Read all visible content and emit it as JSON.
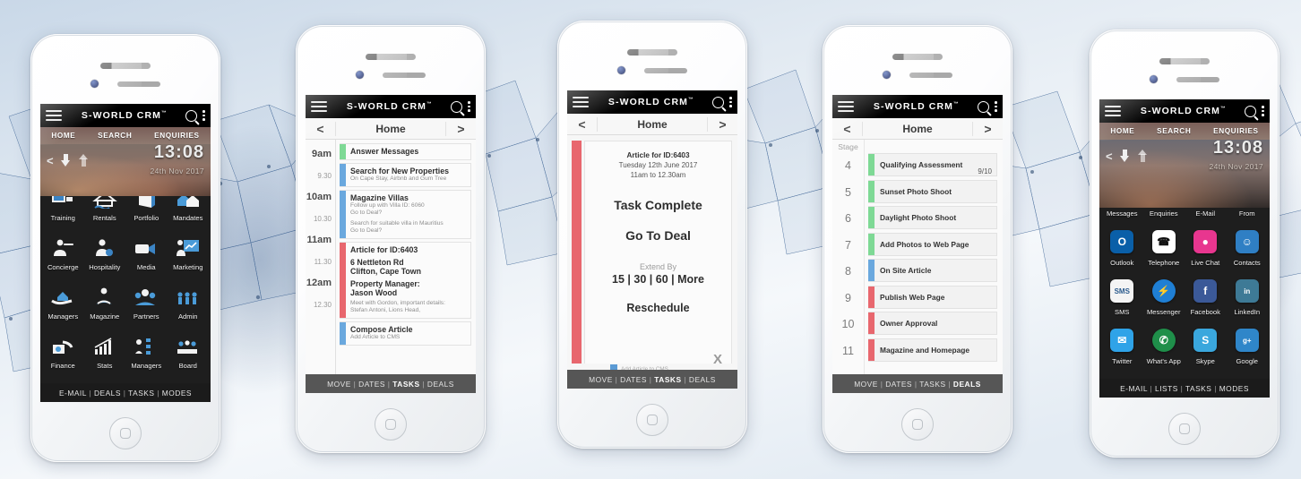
{
  "app": {
    "brand": "S-WORLD CRM",
    "brand_tm": "™",
    "icons": {
      "menu": "hamburger-icon",
      "search": "search-icon",
      "overflow": "kebab-menu-icon"
    }
  },
  "colors": {
    "green": "#7ed995",
    "blue": "#6aa8de",
    "red": "#e8676e",
    "bar_dark": "#1b1b1b",
    "bar_grey": "#565656",
    "accent_blue": "#1c4d86"
  },
  "phone1": {
    "subnav": [
      "HOME",
      "SEARCH",
      "ENQUIRIES"
    ],
    "clock": {
      "time": "13:08",
      "date": "24th Nov 2017",
      "back": "<",
      "download": "download-icon",
      "upload": "upload-icon"
    },
    "tiles": [
      {
        "label": "Training",
        "icon": "training-board-icon"
      },
      {
        "label": "Rentals",
        "icon": "house-water-icon"
      },
      {
        "label": "Portfolio",
        "icon": "portfolio-folder-icon"
      },
      {
        "label": "Mandates",
        "icon": "two-houses-icon"
      },
      {
        "label": "Concierge",
        "icon": "waiter-icon"
      },
      {
        "label": "Hospitality",
        "icon": "hostess-gear-icon"
      },
      {
        "label": "Media",
        "icon": "video-camera-icon"
      },
      {
        "label": "Marketing",
        "icon": "presenter-chart-icon"
      },
      {
        "label": "Managers",
        "icon": "hand-house-icon"
      },
      {
        "label": "Magazine",
        "icon": "reading-person-icon"
      },
      {
        "label": "Partners",
        "icon": "people-group-icon"
      },
      {
        "label": "Admin",
        "icon": "people-gears-icon"
      },
      {
        "label": "Finance",
        "icon": "hand-money-icon"
      },
      {
        "label": "Stats",
        "icon": "bar-chart-icon"
      },
      {
        "label": "Managers",
        "icon": "org-chart-icon"
      },
      {
        "label": "Board",
        "icon": "boardroom-icon"
      }
    ],
    "bottom": {
      "items": [
        "E-MAIL",
        "DEALS",
        "TASKS",
        "MODES"
      ],
      "active": ""
    }
  },
  "phone2": {
    "nav": {
      "prev": "<",
      "title": "Home",
      "next": ">"
    },
    "times": [
      "9am",
      "9.30",
      "10am",
      "10.30",
      "11am",
      "11.30",
      "12am",
      "12.30"
    ],
    "events": [
      {
        "color": "green",
        "title": "Answer Messages",
        "lines": []
      },
      {
        "color": "blue",
        "title": "Search for New Properties",
        "lines": [
          "On Cape Stay, Airbnb and Gum Tree"
        ]
      },
      {
        "color": "blue",
        "title": "Magazine Villas",
        "lines": [
          "Follow up with Villa ID: 6060",
          "Go to Deal?",
          "",
          "Search for suitable villa in Mauritius",
          "Go to Deal?"
        ]
      },
      {
        "color": "red",
        "title": "Article for ID:6403",
        "lines": [
          "6 Nettleton Rd",
          "Clifton, Cape Town",
          "Property Manager:",
          "Jason Wood",
          "Meet with Gordon, important details:",
          "Stefan Antoni, Lions Head,"
        ]
      },
      {
        "color": "blue",
        "title": "Compose Article",
        "lines": [
          "Add Article to CMS"
        ]
      }
    ],
    "bottom": {
      "items": [
        "MOVE",
        "DATES",
        "TASKS",
        "DEALS"
      ],
      "active": "TASKS"
    }
  },
  "phone3": {
    "nav": {
      "prev": "<",
      "title": "Home",
      "next": ">"
    },
    "card": {
      "heading": "Article for ID:6403",
      "date": "Tuesday 12th June 2017",
      "time": "11am to 12.30am",
      "status": "Task Complete",
      "deal_link": "Go To Deal",
      "extend_label": "Extend By",
      "extend_options": "15 | 30 | 60 | More",
      "reschedule": "Reschedule",
      "close": "X"
    },
    "footer_event": "Add Article to CMS",
    "bottom": {
      "items": [
        "MOVE",
        "DATES",
        "TASKS",
        "DEALS"
      ],
      "active": "TASKS"
    }
  },
  "phone4": {
    "nav": {
      "prev": "<",
      "title": "Home",
      "next": ">"
    },
    "stage_header": "Stage",
    "stages": [
      {
        "n": "4",
        "color": "green",
        "label": "Qualifying  Assessment",
        "score": "9/10"
      },
      {
        "n": "5",
        "color": "green",
        "label": "Sunset Photo Shoot",
        "score": ""
      },
      {
        "n": "6",
        "color": "green",
        "label": "Daylight Photo Shoot",
        "score": ""
      },
      {
        "n": "7",
        "color": "green",
        "label": "Add Photos to Web Page",
        "score": ""
      },
      {
        "n": "8",
        "color": "blue",
        "label": "On Site Article",
        "score": ""
      },
      {
        "n": "9",
        "color": "red",
        "label": "Publish Web Page",
        "score": ""
      },
      {
        "n": "10",
        "color": "red",
        "label": "Owner Approval",
        "score": ""
      },
      {
        "n": "11",
        "color": "red",
        "label": "Magazine and Homepage",
        "score": ""
      }
    ],
    "bottom": {
      "items": [
        "MOVE",
        "DATES",
        "TASKS",
        "DEALS"
      ],
      "active": "DEALS"
    }
  },
  "phone5": {
    "subnav": [
      "HOME",
      "SEARCH",
      "ENQUIRIES"
    ],
    "clock": {
      "time": "13:08",
      "date": "24th Nov 2017",
      "back": "<",
      "download": "download-icon",
      "upload": "upload-icon"
    },
    "tiles": [
      {
        "label": "Messages",
        "icon": "chat-bubbles-icon",
        "bg": "#2e9bd6",
        "fg": "#ffffff",
        "glyph": "●",
        "shape": "circ"
      },
      {
        "label": "Enquiries",
        "icon": "monitor-plane-icon",
        "bg": "#f2f2f2",
        "fg": "#222222",
        "glyph": "✈",
        "shape": "tile"
      },
      {
        "label": "E-Mail",
        "icon": "paper-plane-icon",
        "bg": "#4a9fd8",
        "fg": "#ffffff",
        "glyph": "➤",
        "shape": "tile"
      },
      {
        "label": "From",
        "icon": "share-nodes-icon",
        "bg": "#ffffff",
        "fg": "#2e7dbd",
        "glyph": "✷",
        "shape": "tile"
      },
      {
        "label": "Outlook",
        "icon": "outlook-icon",
        "bg": "#0a5fa8",
        "fg": "#ffffff",
        "glyph": "O",
        "shape": "tile"
      },
      {
        "label": "Telephone",
        "icon": "telephone-icon",
        "bg": "#ffffff",
        "fg": "#111111",
        "glyph": "☎",
        "shape": "tile"
      },
      {
        "label": "Live Chat",
        "icon": "live-chat-icon",
        "bg": "#e8368f",
        "fg": "#ffffff",
        "glyph": "●",
        "shape": "tile"
      },
      {
        "label": "Contacts",
        "icon": "contacts-icon",
        "bg": "#2f7fc4",
        "fg": "#ffffff",
        "glyph": "☺",
        "shape": "tile"
      },
      {
        "label": "SMS",
        "icon": "sms-icon",
        "bg": "#f4f4f4",
        "fg": "#2a5a8c",
        "glyph": "SMS",
        "shape": "tile"
      },
      {
        "label": "Messenger",
        "icon": "messenger-icon",
        "bg": "#1f7fd4",
        "fg": "#ffffff",
        "glyph": "⚡",
        "shape": "circ"
      },
      {
        "label": "Facebook",
        "icon": "facebook-icon",
        "bg": "#3b5998",
        "fg": "#ffffff",
        "glyph": "f",
        "shape": "tile"
      },
      {
        "label": "LinkedIn",
        "icon": "linkedin-icon",
        "bg": "#3e7a96",
        "fg": "#ffffff",
        "glyph": "in",
        "shape": "tile"
      },
      {
        "label": "Twitter",
        "icon": "twitter-icon",
        "bg": "#2fa3e8",
        "fg": "#ffffff",
        "glyph": "✉",
        "shape": "tile"
      },
      {
        "label": "What's App",
        "icon": "whatsapp-icon",
        "bg": "#1f8f4a",
        "fg": "#ffffff",
        "glyph": "✆",
        "shape": "circ"
      },
      {
        "label": "Skype",
        "icon": "skype-icon",
        "bg": "#3aa7dd",
        "fg": "#ffffff",
        "glyph": "S",
        "shape": "tile"
      },
      {
        "label": "Google",
        "icon": "google-plus-icon",
        "bg": "#2f86c9",
        "fg": "#ffffff",
        "glyph": "g+",
        "shape": "tile"
      }
    ],
    "bottom": {
      "items": [
        "E-MAIL",
        "LISTS",
        "TASKS",
        "MODES"
      ],
      "active": ""
    }
  }
}
